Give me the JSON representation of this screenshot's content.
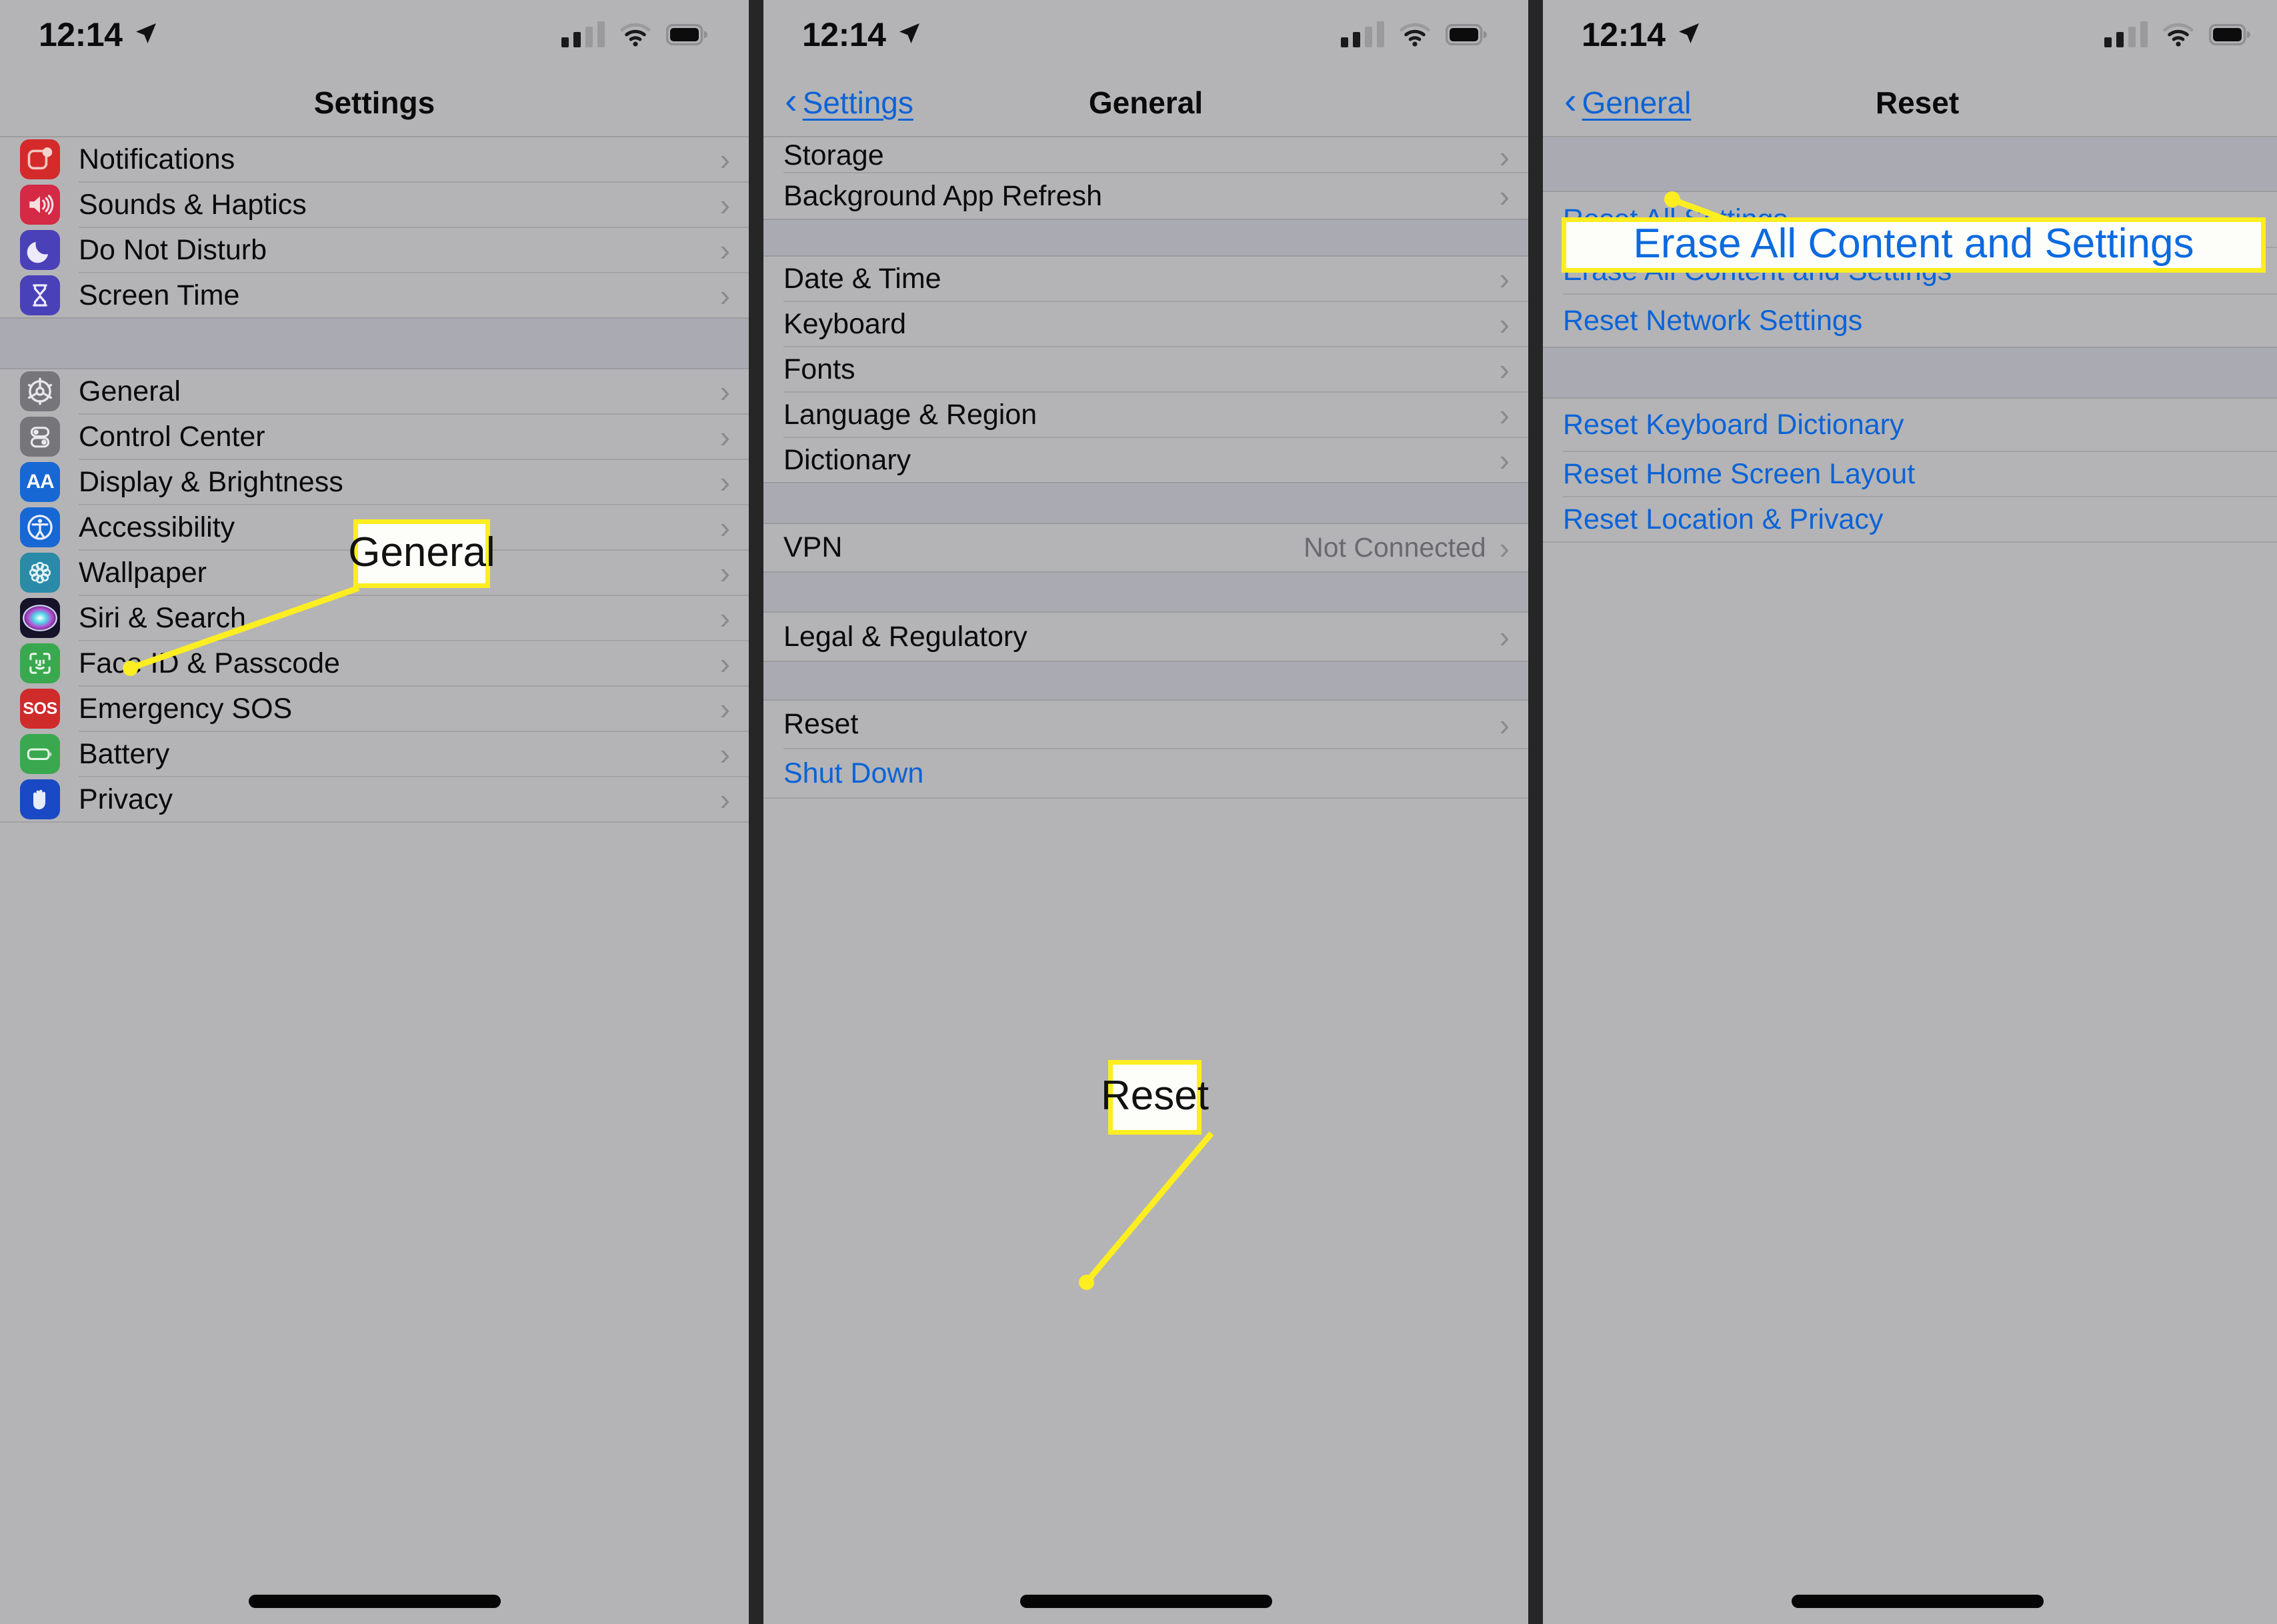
{
  "status_bar": {
    "time": "12:14",
    "location_icon": "location-arrow-icon",
    "signal_icon": "cellular-signal-icon",
    "wifi_icon": "wifi-icon",
    "battery_icon": "battery-icon"
  },
  "panel1": {
    "nav": {
      "title": "Settings"
    },
    "groups": [
      {
        "items": [
          {
            "label": "Notifications",
            "icon": "notifications-icon",
            "chevron": "›"
          },
          {
            "label": "Sounds & Haptics",
            "icon": "sounds-haptics-icon",
            "chevron": "›"
          },
          {
            "label": "Do Not Disturb",
            "icon": "do-not-disturb-icon",
            "chevron": "›"
          },
          {
            "label": "Screen Time",
            "icon": "screen-time-icon",
            "chevron": "›"
          }
        ]
      },
      {
        "items": [
          {
            "label": "General",
            "icon": "general-gear-icon",
            "chevron": "›"
          },
          {
            "label": "Control Center",
            "icon": "control-center-icon",
            "chevron": "›"
          },
          {
            "label": "Display & Brightness",
            "icon": "display-brightness-icon",
            "chevron": "›"
          },
          {
            "label": "Accessibility",
            "icon": "accessibility-icon",
            "chevron": "›"
          },
          {
            "label": "Wallpaper",
            "icon": "wallpaper-icon",
            "chevron": "›"
          },
          {
            "label": "Siri & Search",
            "icon": "siri-search-icon",
            "chevron": "›"
          },
          {
            "label": "Face ID & Passcode",
            "icon": "face-id-icon",
            "chevron": "›"
          },
          {
            "label": "Emergency SOS",
            "icon": "emergency-sos-icon",
            "chevron": "›"
          },
          {
            "label": "Battery",
            "icon": "battery-settings-icon",
            "chevron": "›"
          },
          {
            "label": "Privacy",
            "icon": "privacy-hand-icon",
            "chevron": "›"
          }
        ]
      }
    ],
    "callout": {
      "text": "General"
    }
  },
  "panel2": {
    "nav": {
      "back_label": "Settings",
      "title": "General"
    },
    "rows": [
      {
        "label": "Storage",
        "chevron": "›"
      },
      {
        "label": "Background App Refresh",
        "chevron": "›"
      },
      {
        "label": "Date & Time",
        "chevron": "›"
      },
      {
        "label": "Keyboard",
        "chevron": "›"
      },
      {
        "label": "Fonts",
        "chevron": "›"
      },
      {
        "label": "Language & Region",
        "chevron": "›"
      },
      {
        "label": "Dictionary",
        "chevron": "›"
      },
      {
        "label": "VPN",
        "value": "Not Connected",
        "chevron": "›"
      },
      {
        "label": "Legal & Regulatory",
        "chevron": "›"
      },
      {
        "label": "Reset",
        "chevron": "›"
      },
      {
        "label": "Shut Down",
        "link": true
      }
    ],
    "callout": {
      "text": "Reset"
    }
  },
  "panel3": {
    "nav": {
      "back_label": "General",
      "title": "Reset"
    },
    "rows": [
      {
        "label": "Reset All Settings"
      },
      {
        "label": "Erase All Content and Settings"
      },
      {
        "label": "Reset Network Settings"
      },
      {
        "label": "Reset Keyboard Dictionary"
      },
      {
        "label": "Reset Home Screen Layout"
      },
      {
        "label": "Reset Location & Privacy"
      }
    ],
    "callout": {
      "text": "Erase All Content and Settings"
    }
  },
  "colors": {
    "panel_bg": "#b4b4b6",
    "group_gap": "#aaaab2",
    "link_blue": "#0b63d6",
    "callout_border": "#fcee20",
    "divider": "#262626"
  }
}
